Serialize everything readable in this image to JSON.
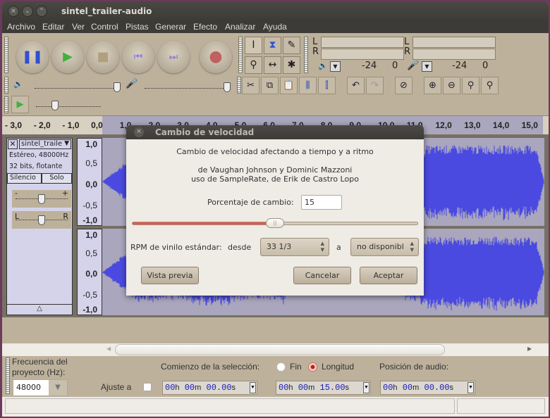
{
  "window": {
    "title": "sintel_trailer-audio"
  },
  "menu": [
    "Archivo",
    "Editar",
    "Ver",
    "Control",
    "Pistas",
    "Generar",
    "Efecto",
    "Analizar",
    "Ayuda"
  ],
  "meters": {
    "left_labels": [
      "L",
      "R"
    ],
    "scale_play": [
      "-24",
      "0"
    ],
    "scale_rec": [
      "-24",
      "0"
    ]
  },
  "ruler": {
    "labels": [
      "- 3,0",
      "- 2,0",
      "- 1,0",
      "0,0",
      "1,0",
      "2,0",
      "3,0",
      "4,0",
      "5,0",
      "6,0",
      "7,0",
      "8,0",
      "9,0",
      "10,0",
      "11,0",
      "12,0",
      "13,0",
      "14,0",
      "15,0"
    ]
  },
  "track": {
    "name": "sintel_traile",
    "info1": "Estéreo, 48000Hz",
    "info2": "32 bits, flotante",
    "mute": "Silencio",
    "solo": "Solo",
    "gain_minus": "-",
    "gain_plus": "+",
    "pan_left": "L",
    "pan_right": "R",
    "scale": [
      "1,0",
      "0,5",
      "0,0",
      "-0,5",
      "-1,0"
    ]
  },
  "dialog": {
    "title": "Cambio de velocidad",
    "heading": "Cambio de velocidad afectando a tiempo y a ritmo",
    "credit1": "de Vaughan Johnson y Dominic Mazzoni",
    "credit2": "uso de SampleRate, de Erik de Castro Lopo",
    "percent_label": "Porcentaje de cambio:",
    "percent_value": "15",
    "slider_fraction": 0.5,
    "rpm_label": "RPM de vinilo estándar:",
    "from_label": "desde",
    "from_value": "33 1/3",
    "to_label": "a",
    "to_value": "no disponibl",
    "preview": "Vista previa",
    "cancel": "Cancelar",
    "ok": "Aceptar"
  },
  "selection": {
    "rate_label1": "Frecuencia del",
    "rate_label2": "proyecto (Hz):",
    "rate_value": "48000",
    "start_label": "Comienzo de la selección:",
    "end_option": "Fin",
    "length_option": "Longitud",
    "length_selected": true,
    "snap_label": "Ajuste a",
    "position_label": "Posición de audio:",
    "start": {
      "h": "00",
      "m": "00",
      "s": "00.00"
    },
    "length": {
      "h": "00",
      "m": "00",
      "s": "15.00"
    },
    "position": {
      "h": "00",
      "m": "00",
      "s": "00.00"
    },
    "units": {
      "h": "h",
      "m": "m",
      "s": "s"
    }
  },
  "colors": {
    "waveform": "#4a4ae0",
    "selection": "#a9a6bd",
    "slider_fill": "#e8564a"
  }
}
